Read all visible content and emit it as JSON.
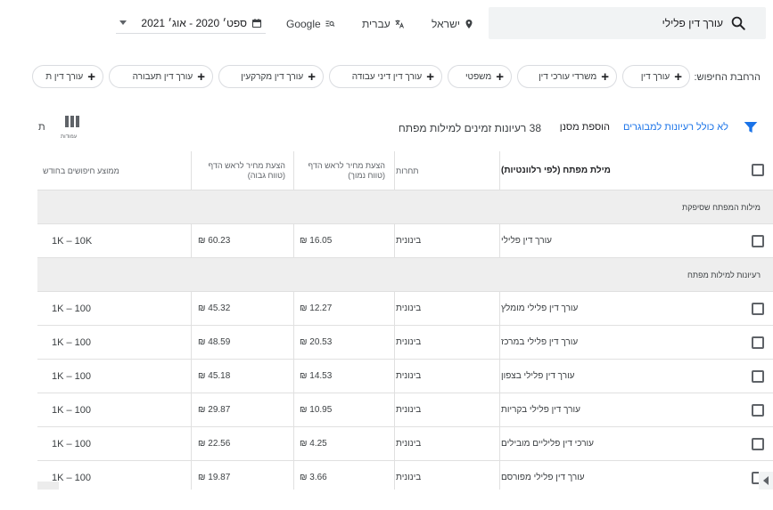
{
  "search": {
    "query": "עורך דין פלילי"
  },
  "top_bar": {
    "location": "ישראל",
    "language": "עברית",
    "network": "Google",
    "date_range": "ספט׳ 2020 - אוג׳ 2021"
  },
  "refine": {
    "label": "הרחבת החיפוש:",
    "chips": [
      "עורך דין",
      "משרדי עורכי דין",
      "משפטי",
      "עורך דין דיני עבודה",
      "עורך דין מקרקעין",
      "עורך דין תעבורה",
      "עורך דין ת"
    ]
  },
  "toolbar": {
    "exclude_link": "לא כולל רעיונות למבוגרים",
    "add_filter": "הוספת מסנן",
    "ideas_count": "38 רעיונות זמינים למילות מפתח",
    "columns_label": "עמודות",
    "cut_letter": "ת"
  },
  "table": {
    "headers": {
      "keyword": "מילת מפתח (לפי רלוונטיות)",
      "competition": "תחרות",
      "bid_low": "הצעת מחיר לראש הדף (טווח נמוך)",
      "bid_high": "הצעת מחיר לראש הדף (טווח גבוה)",
      "avg_searches": "ממוצע חיפושים בחודש"
    },
    "sections": {
      "provided": "מילות המפתח שסיפקת",
      "ideas": "רעיונות למילות מפתח"
    },
    "provided_rows": [
      {
        "keyword": "עורך דין פלילי",
        "competition": "בינונית",
        "bid_low": "₪ 16.05",
        "bid_high": "₪ 60.23",
        "avg": "1K – 10K"
      }
    ],
    "idea_rows": [
      {
        "keyword": "עורך דין פלילי מומלץ",
        "competition": "בינונית",
        "bid_low": "₪ 12.27",
        "bid_high": "₪ 45.32",
        "avg": "1K – 100"
      },
      {
        "keyword": "עורך דין פלילי במרכז",
        "competition": "בינונית",
        "bid_low": "₪ 20.53",
        "bid_high": "₪ 48.59",
        "avg": "1K – 100"
      },
      {
        "keyword": "עורך דין פלילי בצפון",
        "competition": "בינונית",
        "bid_low": "₪ 14.53",
        "bid_high": "₪ 45.18",
        "avg": "1K – 100"
      },
      {
        "keyword": "עורך דין פלילי בקריות",
        "competition": "בינונית",
        "bid_low": "₪ 10.95",
        "bid_high": "₪ 29.87",
        "avg": "1K – 100"
      },
      {
        "keyword": "עורכי דין פליליים מובילים",
        "competition": "בינונית",
        "bid_low": "₪ 4.25",
        "bid_high": "₪ 22.56",
        "avg": "1K – 100"
      },
      {
        "keyword": "עורך דין פלילי מפורסם",
        "competition": "בינונית",
        "bid_low": "₪ 3.66",
        "bid_high": "₪ 19.87",
        "avg": "1K – 100"
      }
    ]
  },
  "colors": {
    "accent": "#1a73e8",
    "section_bg": "#eeeeee",
    "border": "#e0e0e0"
  }
}
